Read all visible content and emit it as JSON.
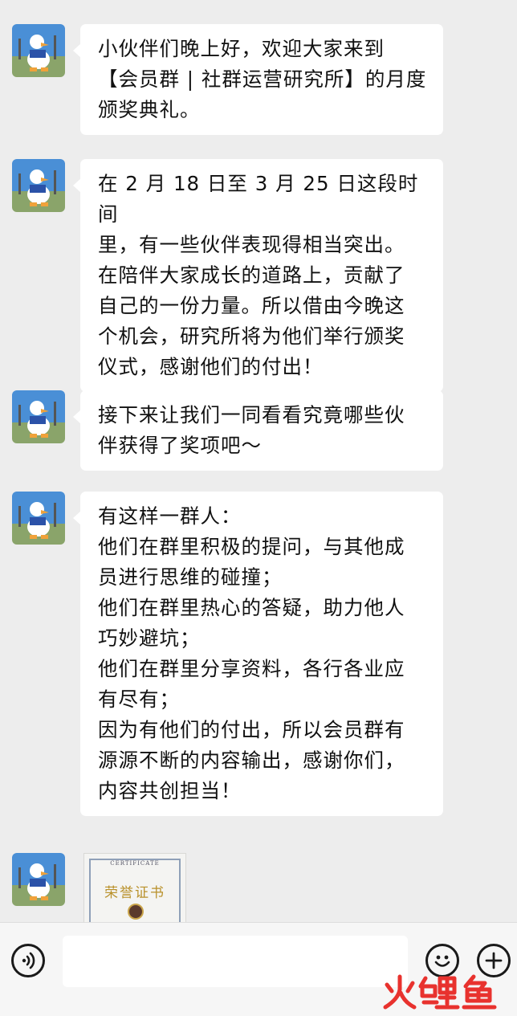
{
  "messages": [
    {
      "text": "小伙伴们晚上好，欢迎大家来到\n【会员群 | 社群运营研究所】的月度\n颁奖典礼。"
    },
    {
      "text": "在 2 月 18 日至 3 月 25 日这段时间\n里，有一些伙伴表现得相当突出。\n在陪伴大家成长的道路上，贡献了\n自己的一份力量。所以借由今晚这\n个机会，研究所将为他们举行颁奖\n仪式，感谢他们的付出！"
    },
    {
      "text": "接下来让我们一同看看究竟哪些伙\n伴获得了奖项吧～"
    },
    {
      "text": "有这样一群人：\n他们在群里积极的提问，与其他成\n员进行思维的碰撞；\n他们在群里热心的答疑，助力他人\n巧妙避坑；\n他们在群里分享资料，各行各业应\n有尽有；\n因为有他们的付出，所以会员群有\n源源不断的内容输出，感谢你们，\n内容共创担当！"
    }
  ],
  "certificate": {
    "header": "CERTIFICATE",
    "title": "荣誉证书"
  },
  "watermark": "火鲤鱼",
  "colors": {
    "background": "#ededed",
    "bubble": "#ffffff",
    "watermark_red": "#e8322e"
  },
  "icons": {
    "voice": "voice-icon",
    "emoji": "emoji-icon",
    "plus": "plus-icon"
  }
}
